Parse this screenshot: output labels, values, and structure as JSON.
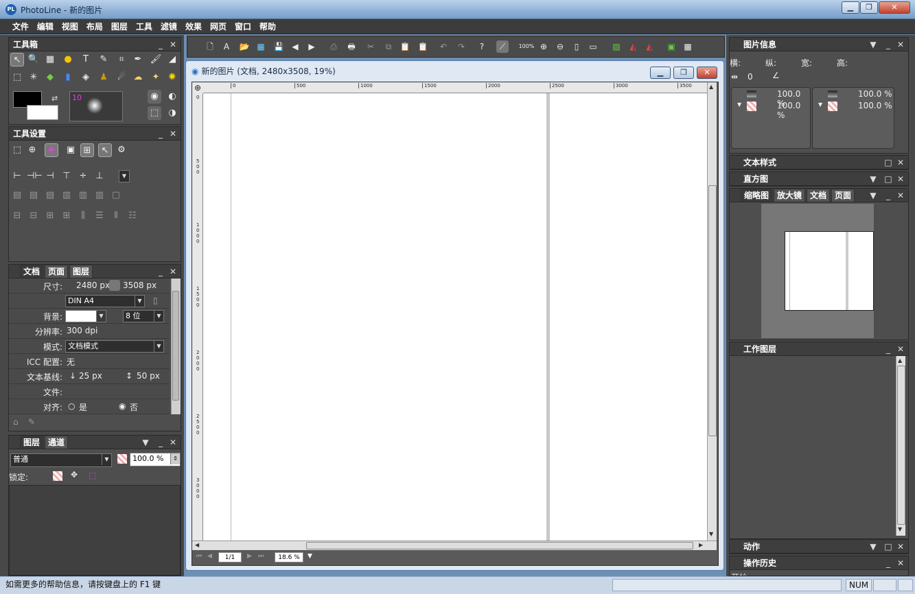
{
  "window": {
    "title": "PhotoLine - 新的图片",
    "app_icon": "PL"
  },
  "menu": [
    "文件",
    "编辑",
    "视图",
    "布局",
    "图层",
    "工具",
    "滤镜",
    "效果",
    "网页",
    "窗口",
    "帮助"
  ],
  "toolbox": {
    "title": "工具箱",
    "brush_size": "10"
  },
  "tool_settings": {
    "title": "工具设置"
  },
  "doc_panel": {
    "tabs": [
      "文档",
      "页面",
      "图层"
    ],
    "size_label": "尺寸:",
    "width": "2480 px",
    "height": "3508 px",
    "paper": "DIN A4",
    "bg_label": "背景:",
    "bit_depth": "8 位",
    "res_label": "分辨率:",
    "resolution": "300 dpi",
    "mode_label": "模式:",
    "mode": "文档模式",
    "icc_label": "ICC 配置:",
    "icc": "无",
    "baseline_label": "文本基线:",
    "baseline1": "25 px",
    "baseline2": "50 px",
    "file_label": "文件:",
    "align_label": "对齐:",
    "align_yes": "是",
    "align_no": "否"
  },
  "layers_panel": {
    "tabs": [
      "图层",
      "通道"
    ],
    "blend": "普通",
    "opacity": "100.0 %",
    "lock_label": "锁定:"
  },
  "toolbar": {
    "zoom_100": "100%"
  },
  "document": {
    "title": "新的图片 (文档, 2480x3508, 19%)",
    "ruler_h": [
      "0",
      "500",
      "1000",
      "1500",
      "2000",
      "2500",
      "3000",
      "3500"
    ],
    "ruler_v": [
      "0",
      "500",
      "1000",
      "1500",
      "2000",
      "2500",
      "3000"
    ],
    "page_field": "1/1",
    "zoom_field": "18.6 %"
  },
  "image_info": {
    "title": "图片信息",
    "h": "横:",
    "v": "纵:",
    "w": "宽:",
    "hh": "高:",
    "dist": "0",
    "pct": [
      "100.0 %",
      "100.0 %",
      "100.0 %",
      "100.0 %"
    ]
  },
  "right_panels": {
    "text_style": "文本样式",
    "histogram": "直方图",
    "nav_tabs": [
      "缩略图",
      "放大镜",
      "文档",
      "页面"
    ],
    "work_layer": "工作图层",
    "actions": "动作",
    "history": "操作历史",
    "history_item": "开始"
  },
  "status": {
    "help": "如需更多的帮助信息，请按键盘上的 F1 键",
    "num": "NUM"
  },
  "colors": {
    "accent": "#4e4e4e",
    "dark": "#3e3e3e",
    "title": "#8fb0d6"
  }
}
